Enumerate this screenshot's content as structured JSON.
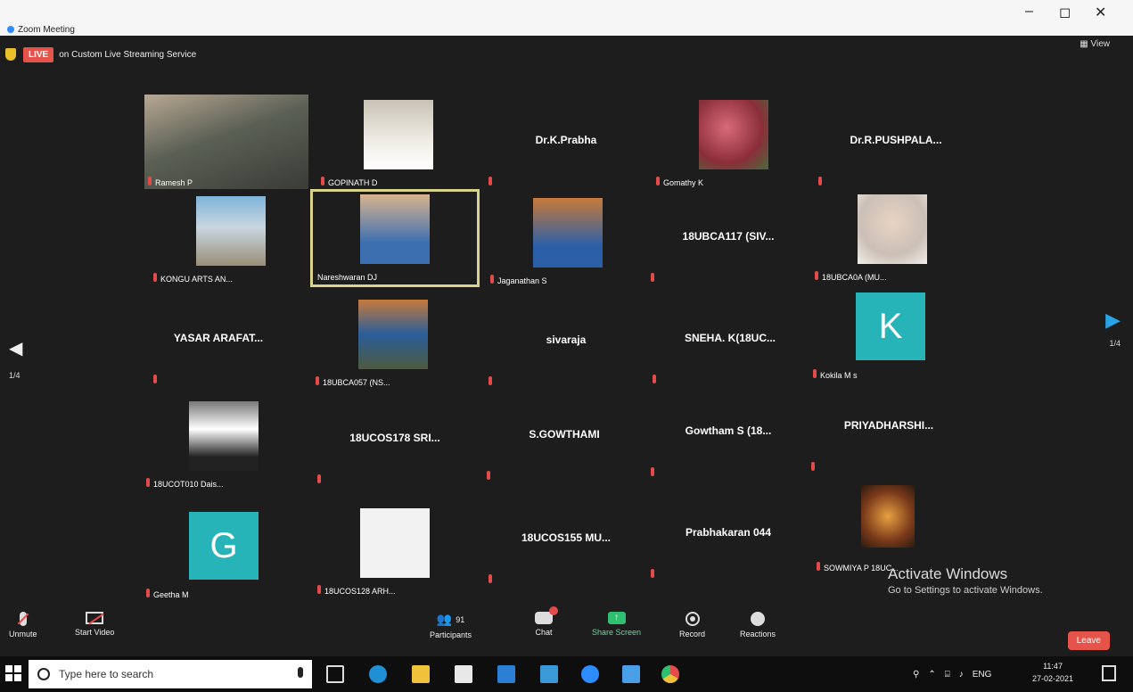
{
  "app": {
    "title": "Zoom Meeting",
    "minimize": "–",
    "maximize": "◻",
    "close": "✕"
  },
  "topbar": {
    "live": "LIVE",
    "stream": "on Custom Live Streaming Service",
    "view": "View"
  },
  "tiles": [
    {
      "label": "Ramesh P"
    },
    {
      "label": "GOPINATH D"
    },
    {
      "center": "Dr.K.Prabha"
    },
    {
      "label": "Gomathy K"
    },
    {
      "center": "Dr.R.PUSHPALA..."
    },
    {
      "label": "KONGU ARTS AN..."
    },
    {
      "label": "Nareshwaran DJ"
    },
    {
      "label": "Jaganathan S"
    },
    {
      "center": "18UBCA117 (SIV..."
    },
    {
      "label": "18UBCA0A (MU..."
    },
    {
      "center": "YASAR ARAFAT..."
    },
    {
      "label": "18UBCA057 (NS..."
    },
    {
      "center": "sivaraja"
    },
    {
      "center": "SNEHA. K(18UC..."
    },
    {
      "label": "Kokila M s",
      "avatar": "K"
    },
    {
      "label": "18UCOT010 Dais..."
    },
    {
      "center": "18UCOS178 SRI..."
    },
    {
      "center": "S.GOWTHAMI"
    },
    {
      "center": "Gowtham S (18..."
    },
    {
      "center": "PRIYADHARSHI..."
    },
    {
      "label": "Geetha M",
      "avatar": "G"
    },
    {
      "label": "18UCOS128 ARH..."
    },
    {
      "center": "18UCOS155 MU..."
    },
    {
      "center": "Prabhakaran 044"
    },
    {
      "label": "SOWMIYA P 18UC..."
    }
  ],
  "nav": {
    "left": "◀",
    "right": "▶",
    "page_left": "1/4",
    "page_right": "1/4"
  },
  "toolbar": {
    "unmute": "Unmute",
    "start_video": "Start Video",
    "participants": "Participants",
    "participants_count": "91",
    "chat": "Chat",
    "share": "Share Screen",
    "record": "Record",
    "reactions": "Reactions",
    "leave": "Leave"
  },
  "activation": {
    "title": "Activate Windows",
    "subtitle": "Go to Settings to activate Windows."
  },
  "taskbar": {
    "search_placeholder": "Type here to search",
    "lang": "ENG",
    "time": "11:47",
    "date": "27-02-2021"
  },
  "colors": {
    "meeting_bg": "#1d1d1d",
    "live": "#e5534b",
    "avatar": "#27b4b8",
    "active_border": "#d9d28a",
    "nav_right": "#28a3e6"
  }
}
